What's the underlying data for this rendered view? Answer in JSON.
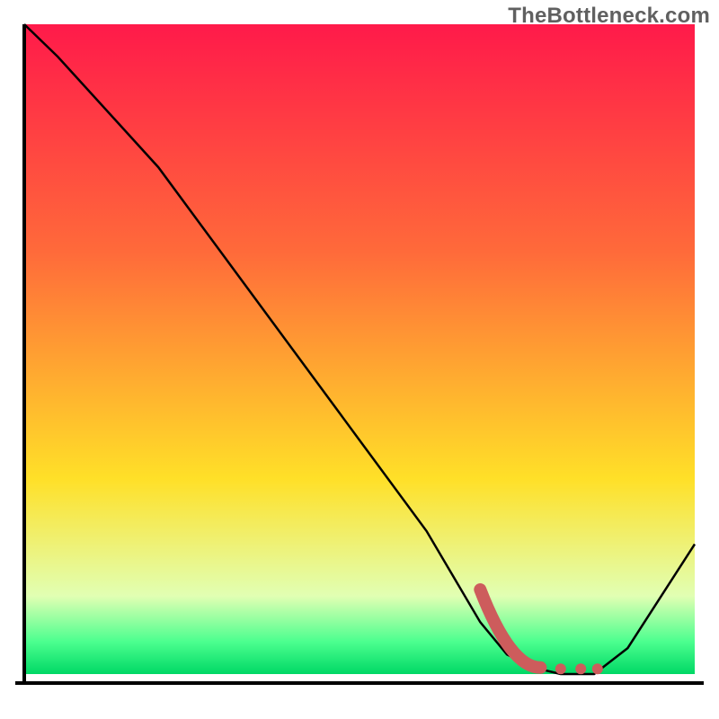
{
  "watermark": "TheBottleneck.com",
  "colors": {
    "gradient_top": "#ff1a4a",
    "gradient_mid1": "#ff6a3a",
    "gradient_mid2": "#ffe028",
    "gradient_green1": "#e1ffb3",
    "gradient_green2": "#4cff8f",
    "gradient_bottom": "#00d865",
    "axis": "#000000",
    "curve": "#000000",
    "marker": "#cd5c5c"
  },
  "chart_data": {
    "type": "line",
    "title": "",
    "xlabel": "",
    "ylabel": "",
    "xlim": [
      0,
      100
    ],
    "ylim": [
      0,
      100
    ],
    "grid": false,
    "legend": false,
    "x": [
      0,
      5,
      20,
      30,
      40,
      50,
      60,
      68,
      72,
      76,
      80,
      85,
      90,
      100
    ],
    "y": [
      100,
      95,
      78,
      64,
      50,
      36,
      22,
      8,
      3,
      1,
      0,
      0,
      4,
      20
    ],
    "markers": {
      "segment": {
        "x1": 68,
        "y1": 13,
        "x2": 77,
        "y2": 1
      },
      "dots": [
        {
          "x": 80,
          "y": 0.8
        },
        {
          "x": 83,
          "y": 0.8
        },
        {
          "x": 85.5,
          "y": 0.8
        }
      ]
    },
    "note": "values are percentages estimated from pixel positions; chart has no visible ticks or labels"
  }
}
